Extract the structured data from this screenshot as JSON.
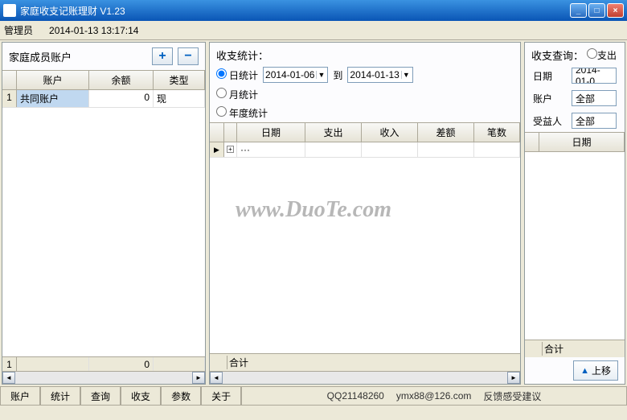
{
  "window": {
    "title": "家庭收支记账理财  V1.23"
  },
  "toolbar": {
    "user": "管理员",
    "datetime": "2014-01-13 13:17:14"
  },
  "leftPanel": {
    "title": "家庭成员账户",
    "plus": "+",
    "minus": "−",
    "columns": {
      "c1": "账户",
      "c2": "余额",
      "c3": "类型"
    },
    "row1": {
      "num": "1",
      "account": "共同账户",
      "balance": "0",
      "type": "现"
    },
    "footer_num": "1",
    "footer_bal": "0"
  },
  "midPanel": {
    "title": "收支统计：",
    "radio_day": "日统计",
    "radio_month": "月统计",
    "radio_year": "年度统计",
    "date_from": "2014-01-06",
    "to_label": "到",
    "date_to": "2014-01-13",
    "columns": {
      "c1": "日期",
      "c2": "支出",
      "c3": "收入",
      "c4": "差额",
      "c5": "笔数"
    },
    "expand": "+",
    "dots": "···",
    "sum_label": "合计"
  },
  "rightPanel": {
    "title": "收支查询：",
    "query_label": "支出",
    "date_label": "日期",
    "date_value": "2014-01-0",
    "account_label": "账户",
    "account_value": "全部",
    "benef_label": "受益人",
    "benef_value": "全部",
    "col_date": "日期",
    "sum_label": "合计",
    "btn_up": "上移"
  },
  "statusbar": {
    "s1": "账户",
    "s2": "统计",
    "s3": "查询",
    "s4": "收支",
    "s5": "参数",
    "s6": "关于",
    "qq": "QQ21148260",
    "email": "ymx88@126.com",
    "feedback": "反馈感受建议"
  },
  "watermark": "www.DuoTe.com"
}
